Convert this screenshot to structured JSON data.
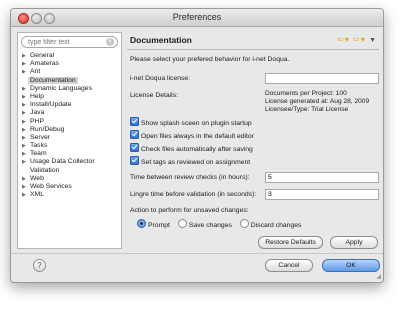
{
  "window": {
    "title": "Preferences"
  },
  "filter": {
    "placeholder": "type filter text"
  },
  "tree": [
    {
      "label": "General",
      "expandable": true
    },
    {
      "label": "Amateras",
      "expandable": true
    },
    {
      "label": "Ant",
      "expandable": true
    },
    {
      "label": "Documentation",
      "expandable": false,
      "selected": true
    },
    {
      "label": "Dynamic Languages",
      "expandable": true
    },
    {
      "label": "Help",
      "expandable": true
    },
    {
      "label": "Install/Update",
      "expandable": true
    },
    {
      "label": "Java",
      "expandable": true
    },
    {
      "label": "PHP",
      "expandable": true
    },
    {
      "label": "Run/Debug",
      "expandable": true
    },
    {
      "label": "Server",
      "expandable": true
    },
    {
      "label": "Tasks",
      "expandable": true
    },
    {
      "label": "Team",
      "expandable": true
    },
    {
      "label": "Usage Data Collector",
      "expandable": true
    },
    {
      "label": "Validation",
      "expandable": false
    },
    {
      "label": "Web",
      "expandable": true
    },
    {
      "label": "Web Services",
      "expandable": true
    },
    {
      "label": "XML",
      "expandable": true
    }
  ],
  "page": {
    "title": "Documentation",
    "intro": "Please select your prefered     behavior for i-net Doqua.",
    "license_label": "i-net Doqua license:",
    "license_value": "",
    "details_label": "License Details:",
    "details": [
      "Documents per Project: 100",
      "License generated at: Aug 28, 2009",
      "Licensee/Type: Trial License"
    ],
    "checks": [
      {
        "label": "Show splash sceen on plugin startup",
        "checked": true
      },
      {
        "label": "Open files always in the default editor",
        "checked": true
      },
      {
        "label": "Check files automatically after saving",
        "checked": true
      },
      {
        "label": "Set tags as reviewed on assignment",
        "checked": true
      }
    ],
    "review_label": "Time between review checks (in hours):",
    "review_value": "5",
    "linger_label": "Lingre time before validation (in seconds):",
    "linger_value": "3",
    "action_label": "Action to perform for unsaved changes:",
    "radio_options": [
      "Prompt",
      "Save changes",
      "Discard changes"
    ],
    "radio_selected": "Prompt",
    "restore_label": "Restore Defaults",
    "apply_label": "Apply"
  },
  "footer": {
    "cancel_label": "Cancel",
    "ok_label": "OK"
  },
  "icons": {
    "help": "help-icon",
    "back": "back-arrow-icon",
    "forward": "forward-arrow-icon",
    "menu": "view-menu-icon"
  },
  "colors": {
    "accent": "#3d7ad8",
    "selection": "#d4d4d4",
    "nav_arrow": "#d9a21a"
  }
}
